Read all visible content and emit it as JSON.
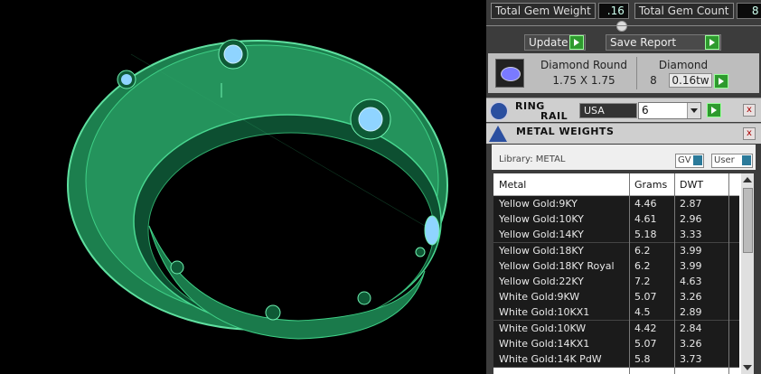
{
  "header": {
    "total_gem_weight_label": "Total Gem Weight",
    "total_gem_weight_value": ".16",
    "total_gem_count_label": "Total Gem Count",
    "total_gem_count_value": "8"
  },
  "actions": {
    "update_label": "Update",
    "save_report_label": "Save Report"
  },
  "gem": {
    "shape": "Diamond Round",
    "size": "1.75 X 1.75",
    "material": "Diamond",
    "count": "8",
    "weight": "0.16tw"
  },
  "ring_rail": {
    "title_line1": "RING",
    "title_line2": "RAIL",
    "region": "USA",
    "size": "6"
  },
  "metal_weights": {
    "title": "METAL WEIGHTS",
    "library_label": "Library: METAL",
    "gv_label": "GV",
    "user_label": "User",
    "columns": [
      "Metal",
      "Grams",
      "DWT"
    ],
    "rows": [
      [
        "Yellow Gold:9KY",
        "4.46",
        "2.87"
      ],
      [
        "Yellow Gold:10KY",
        "4.61",
        "2.96"
      ],
      [
        "Yellow Gold:14KY",
        "5.18",
        "3.33"
      ],
      [
        "Yellow Gold:18KY",
        "6.2",
        "3.99"
      ],
      [
        "Yellow Gold:18KY Royal",
        "6.2",
        "3.99"
      ],
      [
        "Yellow Gold:22KY",
        "7.2",
        "4.63"
      ],
      [
        "White Gold:9KW",
        "5.07",
        "3.26"
      ],
      [
        "White Gold:10KX1",
        "4.5",
        "2.89"
      ],
      [
        "White Gold:10KW",
        "4.42",
        "2.84"
      ],
      [
        "White Gold:14KX1",
        "5.07",
        "3.26"
      ],
      [
        "White Gold:14K PdW",
        "5.8",
        "3.73"
      ]
    ]
  },
  "colors": {
    "ring_green": "#1f8a55",
    "gem_blue": "#7fc8ff",
    "go_green": "#2e9a2e"
  }
}
